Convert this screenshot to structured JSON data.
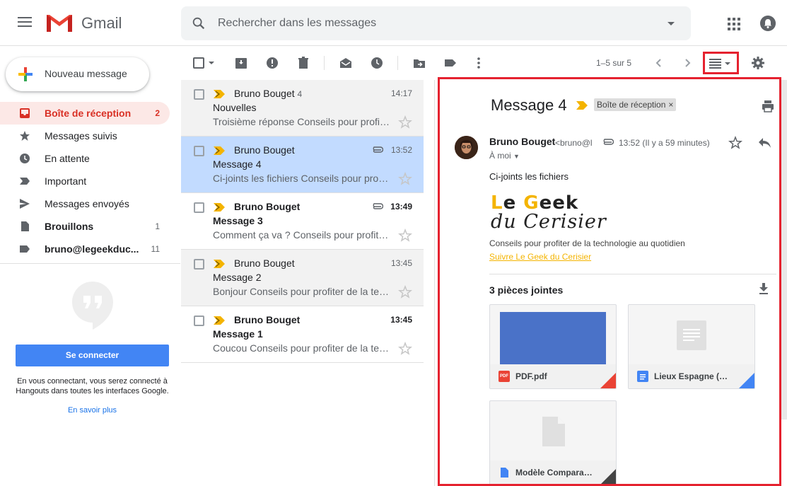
{
  "app": {
    "brand": "Gmail"
  },
  "search": {
    "placeholder": "Rechercher dans les messages"
  },
  "sidebar": {
    "compose_label": "Nouveau message",
    "items": [
      {
        "label": "Boîte de réception",
        "count": "2",
        "icon": "inbox-icon",
        "active": true
      },
      {
        "label": "Messages suivis",
        "count": "",
        "icon": "star-icon"
      },
      {
        "label": "En attente",
        "count": "",
        "icon": "clock-icon"
      },
      {
        "label": "Important",
        "count": "",
        "icon": "important-icon"
      },
      {
        "label": "Messages envoyés",
        "count": "",
        "icon": "send-icon"
      },
      {
        "label": "Brouillons",
        "count": "1",
        "icon": "draft-icon",
        "bold": true
      },
      {
        "label": "bruno@legeekduc...",
        "count": "11",
        "icon": "label-icon",
        "bold": true
      }
    ],
    "hangouts": {
      "connect_label": "Se connecter",
      "text": "En vous connectant, vous serez connecté à Hangouts dans toutes les interfaces Google.",
      "learn_more": "En savoir plus"
    }
  },
  "toolbar": {
    "pager": "1–5 sur 5",
    "icons": [
      "select-all-checkbox",
      "archive-icon",
      "spam-icon",
      "delete-icon",
      "mark-read-icon",
      "snooze-icon",
      "move-to-icon",
      "label-icon",
      "more-icon",
      "prev-page-icon",
      "next-page-icon",
      "split-pane-icon",
      "settings-icon"
    ]
  },
  "mails": [
    {
      "sender": "Bruno Bouget",
      "count": "4",
      "subject": "Nouvelles",
      "snippet": "Troisième réponse Conseils pour profiter de la technologie au quotidien",
      "time": "14:17",
      "state": "read",
      "attachment": false
    },
    {
      "sender": "Bruno Bouget",
      "count": "",
      "subject": "Message 4",
      "snippet": "Ci-joints les fichiers Conseils pour profiter de la technologie au quotidien",
      "time": "13:52",
      "state": "selected",
      "attachment": true
    },
    {
      "sender": "Bruno Bouget",
      "count": "",
      "subject": "Message 3",
      "snippet": "Comment ça va ? Conseils pour profiter de la technologie au quotidien",
      "time": "13:49",
      "state": "unread",
      "attachment": true
    },
    {
      "sender": "Bruno Bouget",
      "count": "",
      "subject": "Message 2",
      "snippet": "Bonjour Conseils pour profiter de la technologie au quotidien",
      "time": "13:45",
      "state": "read",
      "attachment": false
    },
    {
      "sender": "Bruno Bouget",
      "count": "",
      "subject": "Message 1",
      "snippet": "Coucou Conseils pour profiter de la technologie au quotidien",
      "time": "13:45",
      "state": "unread",
      "attachment": false
    }
  ],
  "message": {
    "title": "Message 4",
    "label": "Boîte de réception",
    "label_close": "×",
    "from_name": "Bruno Bouget",
    "from_email": "<bruno@l",
    "time": "13:52 (Il y a 59 minutes)",
    "to": "À moi",
    "body": "Ci-joints les fichiers",
    "signature": {
      "logo_line1": "Le Geek",
      "logo_line2": "du Cerisier",
      "tagline": "Conseils pour profiter de la technologie au quotidien",
      "link": "Suivre Le Geek du Cerisier"
    },
    "attachments_heading": "3 pièces jointes",
    "attachments": [
      {
        "name": "PDF.pdf",
        "badge": "PDF",
        "badge_color": "#ea4335",
        "fold_color": "#ea4335"
      },
      {
        "name": "Lieux Espagne (Nouvelle...",
        "badge": "",
        "badge_color": "#4285f4",
        "fold_color": "#4285f4"
      },
      {
        "name": "Modèle Comparatif...",
        "badge": "",
        "badge_color": "#4285f4",
        "fold_color": "#444444"
      }
    ]
  },
  "colors": {
    "accent_red": "#d93025",
    "highlight_border": "#e5222f",
    "selected_row": "#c2dbff",
    "link_yellow": "#f4b400"
  }
}
